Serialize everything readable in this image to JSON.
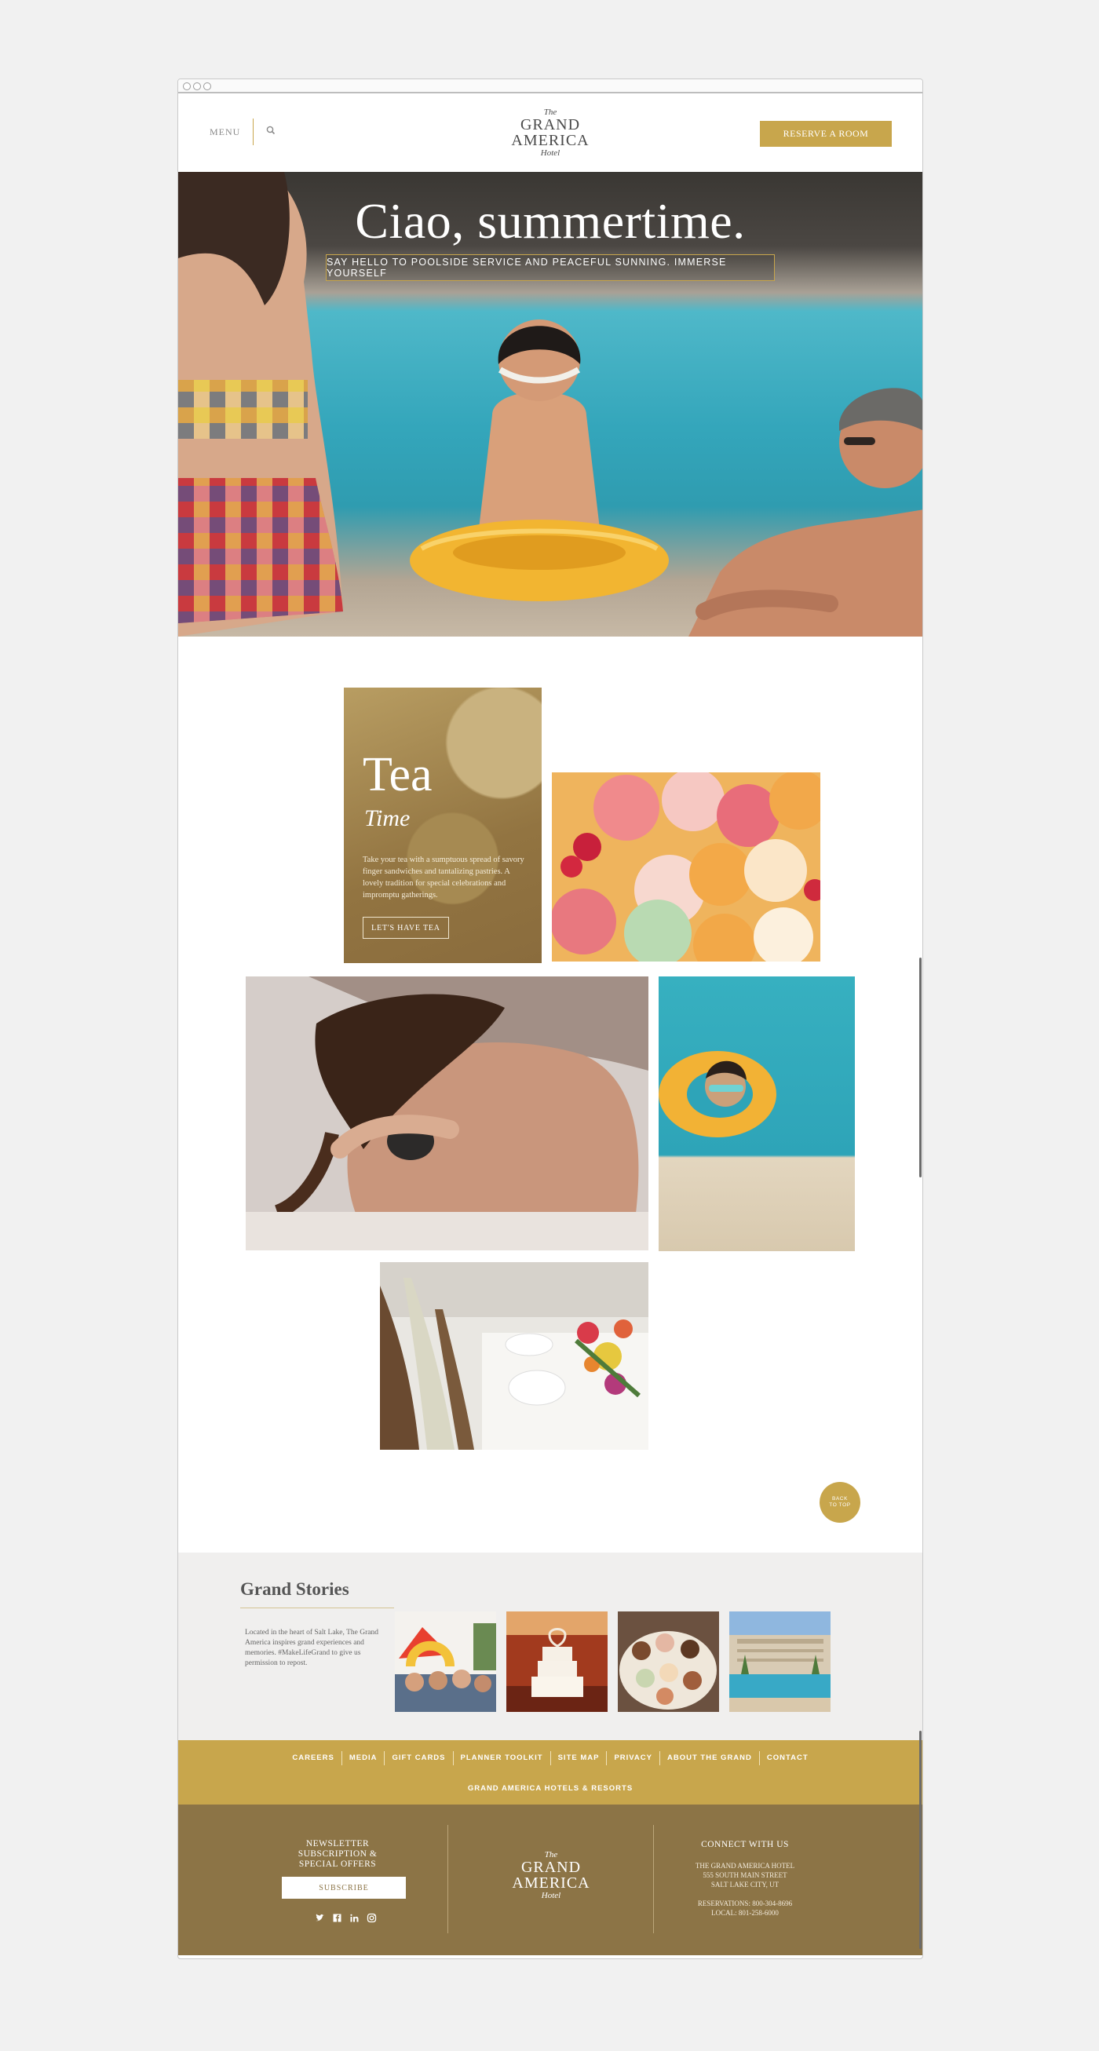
{
  "header": {
    "menu_label": "MENU",
    "logo": {
      "the": "The",
      "line1": "GRAND",
      "line2": "AMERICA",
      "hotel": "Hotel"
    },
    "reserve_label": "RESERVE A ROOM"
  },
  "hero": {
    "title": "Ciao, summertime.",
    "subtitle": "SAY HELLO TO POOLSIDE SERVICE AND PEACEFUL SUNNING. IMMERSE YOURSELF"
  },
  "tea": {
    "title": "Tea",
    "italic": "Time",
    "description": "Take your tea with a sumptuous spread of savory finger sandwiches and tantalizing pastries. A lovely tradition for special celebrations and impromptu gatherings.",
    "button_label": "LET'S HAVE TEA"
  },
  "back_to_top": {
    "line1": "BACK",
    "line2": "TO TOP"
  },
  "stories": {
    "title": "Grand Stories",
    "description": "Located in the heart of Salt Lake, The Grand America inspires grand experiences and memories. #MakeLifeGrand to give us permission to repost."
  },
  "footer_links": {
    "items": [
      "CAREERS",
      "MEDIA",
      "GIFT CARDS",
      "PLANNER TOOLKIT",
      "SITE MAP",
      "PRIVACY",
      "ABOUT THE GRAND",
      "CONTACT"
    ],
    "brand_link": "GRAND AMERICA HOTELS & RESORTS"
  },
  "footer": {
    "newsletter_title": "NEWSLETTER SUBSCRIPTION & SPECIAL OFFERS",
    "subscribe_label": "SUBSCRIBE",
    "socials": [
      "twitter-icon",
      "facebook-icon",
      "linkedin-icon",
      "instagram-icon"
    ],
    "connect_title": "CONNECT WITH US",
    "address_line1": "THE GRAND AMERICA HOTEL",
    "address_line2": "555 SOUTH MAIN STREET",
    "address_line3": "SALT LAKE CITY, UT",
    "reservations": "RESERVATIONS: 800-304-8696",
    "local": "LOCAL: 801-258-6000"
  },
  "colors": {
    "gold": "#c8a64c",
    "footer_brown": "#8c7446"
  }
}
